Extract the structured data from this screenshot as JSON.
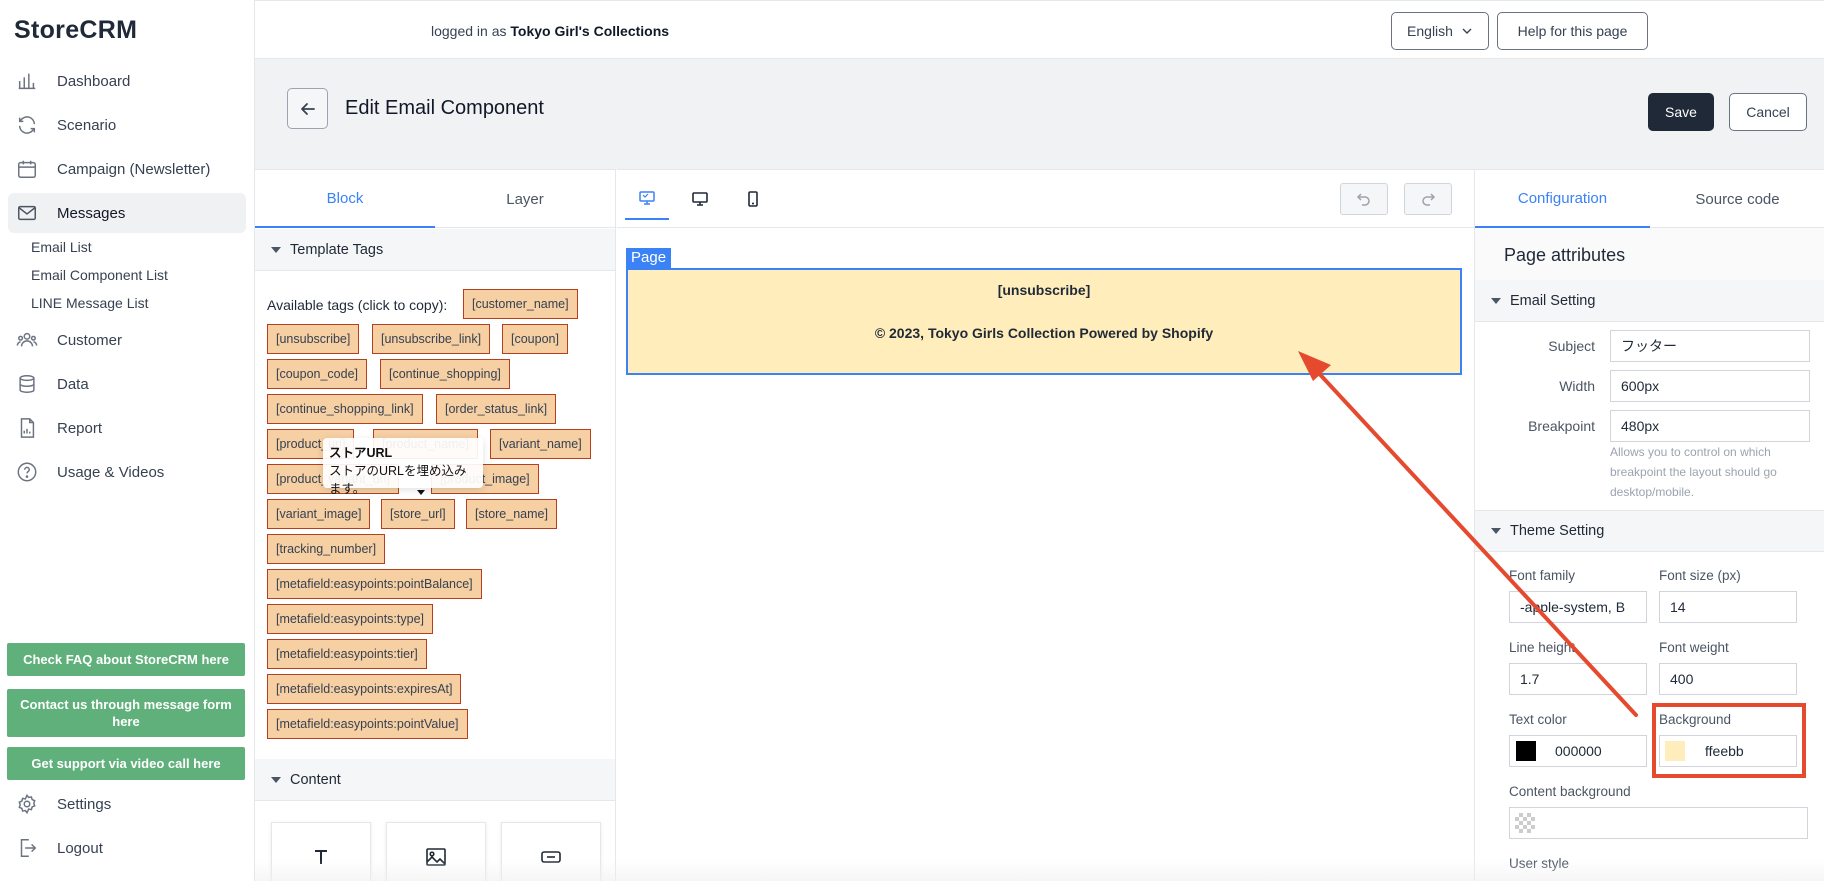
{
  "app": {
    "logo": "StoreCRM"
  },
  "sidebar": {
    "items": [
      {
        "label": "Dashboard",
        "icon": "bar-chart-icon"
      },
      {
        "label": "Scenario",
        "icon": "refresh-icon"
      },
      {
        "label": "Campaign (Newsletter)",
        "icon": "calendar-icon"
      },
      {
        "label": "Messages",
        "icon": "mail-icon"
      },
      {
        "label": "Customer",
        "icon": "users-icon"
      },
      {
        "label": "Data",
        "icon": "database-icon"
      },
      {
        "label": "Report",
        "icon": "file-chart-icon"
      },
      {
        "label": "Usage & Videos",
        "icon": "help-circle-icon"
      }
    ],
    "messages_sub": [
      "Email List",
      "Email Component List",
      "LINE Message List"
    ],
    "support_buttons": [
      "Check FAQ about StoreCRM here",
      "Contact us through message form here",
      "Get support via video call here"
    ],
    "settings_label": "Settings",
    "logout_label": "Logout"
  },
  "topbar": {
    "logged_prefix": "logged in as",
    "store_name": "Tokyo Girl's Collections",
    "language": "English",
    "help_label": "Help for this page"
  },
  "header": {
    "title": "Edit Email Component",
    "save_label": "Save",
    "cancel_label": "Cancel"
  },
  "left_panel": {
    "tabs": [
      "Block",
      "Layer"
    ],
    "template_tags_title": "Template Tags",
    "available_label": "Available tags (click to copy):",
    "tags": {
      "t0": "[customer_name]",
      "t1": "[unsubscribe]",
      "t2": "[unsubscribe_link]",
      "t3": "[coupon]",
      "t4": "[coupon_code]",
      "t5": "[continue_shopping]",
      "t6": "[continue_shopping_link]",
      "t7": "[order_status_link]",
      "t8": "[product_url]",
      "t9": "[product_name]",
      "t10": "[variant_name]",
      "t11": "[product_variant_url]",
      "t12": "[product_image]",
      "t13": "[variant_image]",
      "t14": "[store_url]",
      "t15": "[store_name]",
      "t16": "[tracking_number]",
      "t17": "[metafield:easypoints:pointBalance]",
      "t18": "[metafield:easypoints:type]",
      "t19": "[metafield:easypoints:tier]",
      "t20": "[metafield:easypoints:expiresAt]",
      "t21": "[metafield:easypoints:pointValue]"
    },
    "tooltip_title": "ストアURL",
    "tooltip_text": "ストアのURLを埋め込みます。",
    "content_title": "Content"
  },
  "canvas": {
    "page_label": "Page",
    "unsubscribe_text": "[unsubscribe]",
    "footer_text": "© 2023, Tokyo Girls Collection Powered by Shopify",
    "background_color": "#ffeebb"
  },
  "right_panel": {
    "tabs": [
      "Configuration",
      "Source code"
    ],
    "title": "Page attributes",
    "email_setting": {
      "section": "Email Setting",
      "subject_label": "Subject",
      "subject_value": "フッター",
      "width_label": "Width",
      "width_value": "600px",
      "breakpoint_label": "Breakpoint",
      "breakpoint_value": "480px",
      "breakpoint_help": "Allows you to control on which breakpoint the layout should go desktop/mobile."
    },
    "theme_setting": {
      "section": "Theme Setting",
      "font_family_label": "Font family",
      "font_family_value": "-apple-system, B",
      "font_size_label": "Font size (px)",
      "font_size_value": "14",
      "line_height_label": "Line height",
      "line_height_value": "1.7",
      "font_weight_label": "Font weight",
      "font_weight_value": "400",
      "text_color_label": "Text color",
      "text_color_value": "000000",
      "background_label": "Background",
      "background_value": "ffeebb",
      "content_bg_label": "Content background",
      "user_style_label": "User style"
    }
  },
  "annotation": {
    "color": "#e64a2e"
  }
}
